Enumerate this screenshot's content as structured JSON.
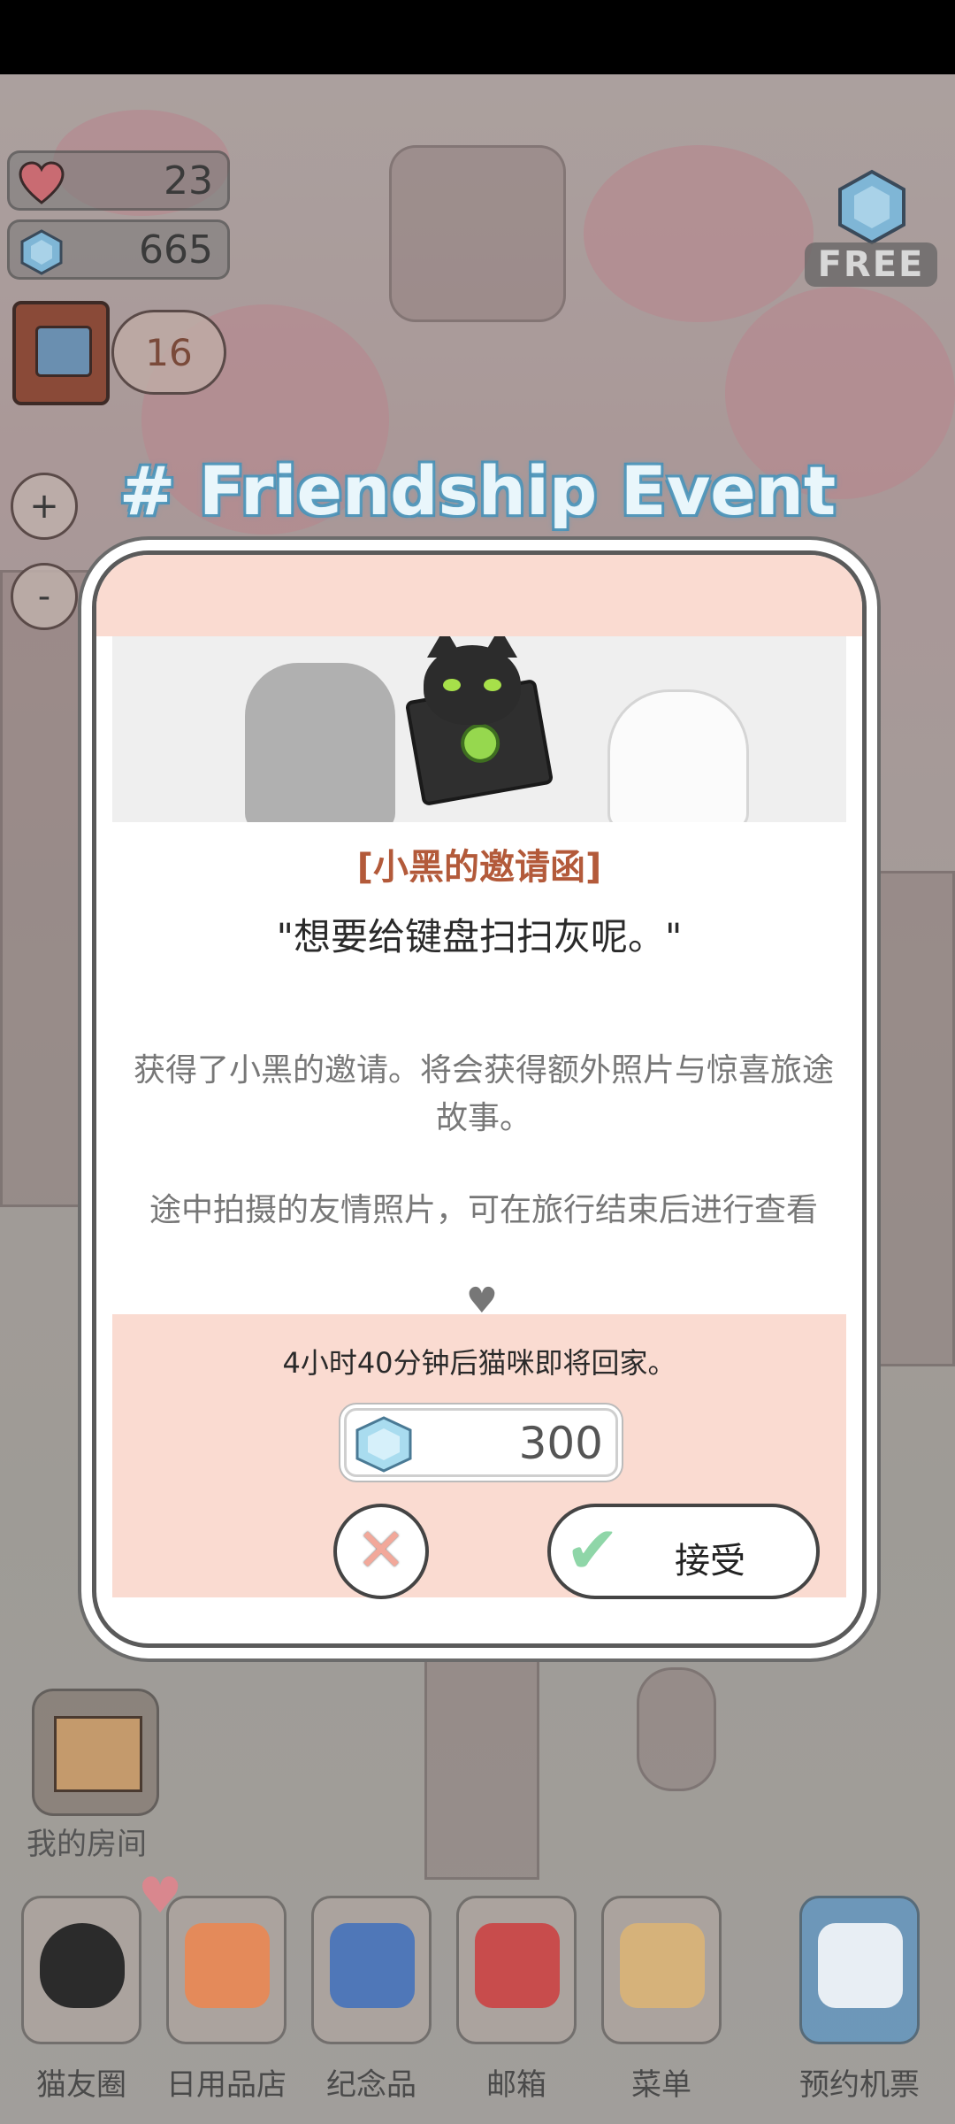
{
  "hud": {
    "hearts": "23",
    "gems": "665",
    "book_badge": "16",
    "zoom_in": "+",
    "zoom_out": "-",
    "free_label": "FREE"
  },
  "event": {
    "title": "# Friendship Event",
    "invite_title": "[小黑的邀请函]",
    "quote": "\"想要给键盘扫扫灰呢。\"",
    "desc_line1": "获得了小黑的邀请。将会获得额外照片与惊喜旅途故事。",
    "desc_line2": "途中拍摄的友情照片，可在旅行结束后进行查看",
    "return_time": "4小时40分钟后猫咪即将回家。",
    "cost": "300",
    "accept_label": "接受"
  },
  "room": {
    "label": "我的房间"
  },
  "nav": [
    {
      "label": "猫友圈",
      "icon": "cat-icon"
    },
    {
      "label": "日用品店",
      "icon": "shop-icon"
    },
    {
      "label": "纪念品",
      "icon": "box-icon"
    },
    {
      "label": "邮箱",
      "icon": "mailbox-icon"
    },
    {
      "label": "菜单",
      "icon": "folder-icon"
    },
    {
      "label": "预约机票",
      "icon": "plane-icon"
    }
  ],
  "colors": {
    "dialog_peach": "#fadbd1",
    "invite_title": "#b35a3a",
    "title_glow": "#5fa3c4",
    "accept_check": "#8fd6a8",
    "close_x": "#f2a89a"
  }
}
